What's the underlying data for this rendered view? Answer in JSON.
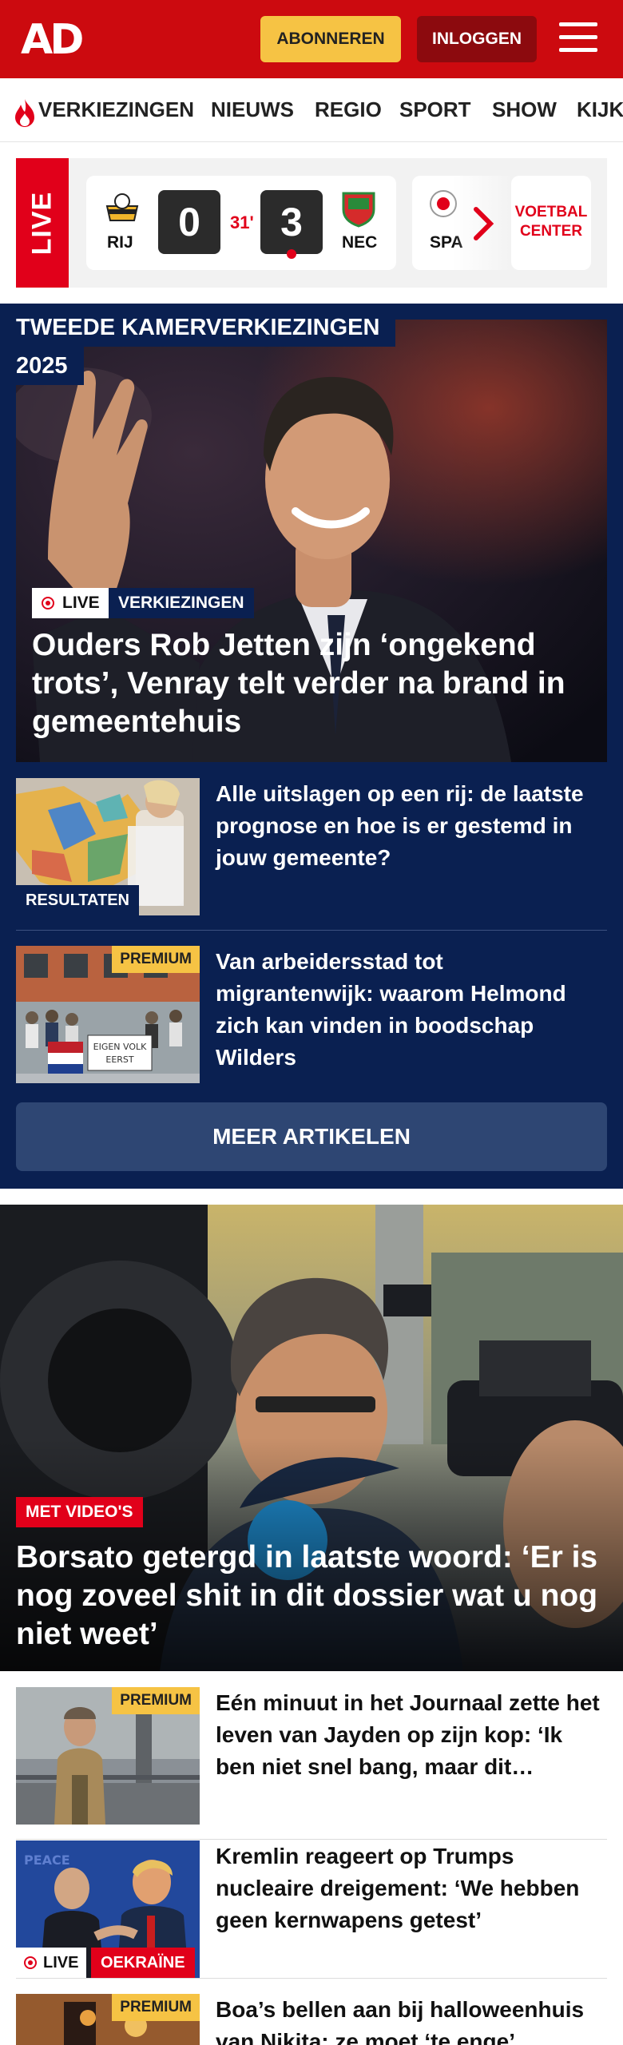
{
  "header": {
    "logo": "AD",
    "subscribe_label": "ABONNEREN",
    "login_label": "INLOGGEN"
  },
  "nav": {
    "items": [
      "VERKIEZINGEN",
      "NIEUWS",
      "REGIO",
      "SPORT",
      "SHOW",
      "KIJK"
    ]
  },
  "live_scores": {
    "tab_label": "LIVE",
    "match": {
      "home_team": "RIJ",
      "home_score": "0",
      "minute": "31'",
      "away_score": "3",
      "away_team": "NEC"
    },
    "next_match_team": "SPA",
    "voetbal_center_label_1": "VOETBAL",
    "voetbal_center_label_2": "CENTER"
  },
  "election": {
    "section_line_1": "TWEEDE KAMERVERKIEZINGEN",
    "section_line_2": "2025",
    "hero": {
      "live_label": "LIVE",
      "category": "VERKIEZINGEN",
      "title": "Ouders Rob Jetten zijn ‘ongekend trots’, Venray telt verder na brand in gemeentehuis"
    },
    "articles": [
      {
        "tag": "RESULTATEN",
        "title": "Alle uitslagen op een rij: de laatste prognose en hoe is er gestemd in jouw gemeente?"
      },
      {
        "tag": "PREMIUM",
        "banner_text": "EIGEN VOLK EERST",
        "title": "Van arbeidersstad tot migrantenwijk: waarom Helmond zich kan vinden in boodschap Wilders"
      }
    ],
    "more_label": "MEER ARTIKELEN"
  },
  "main_story": {
    "badge": "MET VIDEO'S",
    "title": "Borsato getergd in laatste woord: ‘Er is nog zoveel shit in dit dossier wat u nog niet weet’"
  },
  "articles": [
    {
      "tag": "PREMIUM",
      "title": "Eén minuut in het Journaal zette het leven van Jayden op zijn kop: ‘Ik ben niet snel bang, maar dit…"
    },
    {
      "live_label": "LIVE",
      "category": "OEKRAÏNE",
      "title": "Kremlin reageert op Trumps nucleaire dreigement: ‘We hebben geen kernwapens getest’"
    },
    {
      "tag": "PREMIUM",
      "title": "Boa’s bellen aan bij halloweenhuis van Nikita: ze moet ‘te enge’"
    }
  ],
  "colors": {
    "brand_red": "#cc0a0f",
    "accent_yellow": "#f6c344",
    "election_navy": "#0a2051",
    "live_red": "#e1001a"
  }
}
